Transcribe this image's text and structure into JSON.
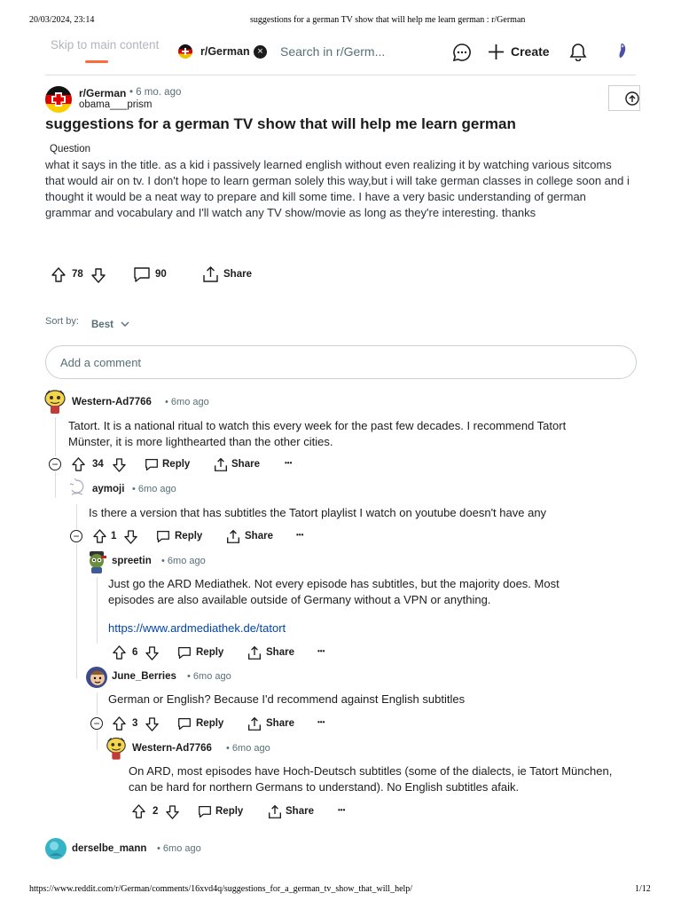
{
  "print_header": {
    "datetime": "20/03/2024, 23:14",
    "doc_title": "suggestions for a german TV show that will help me learn german : r/German"
  },
  "print_footer": {
    "url": "https://www.reddit.com/r/German/comments/16xvd4q/suggestions_for_a_german_tv_show_that_will_help/",
    "page": "1/12"
  },
  "topbar": {
    "skip_link": "Skip to main content",
    "subreddit_chip": "r/German",
    "chip_close": "×",
    "search_placeholder": "Search in r/Germ...",
    "create_label": "Create"
  },
  "post": {
    "subreddit": "r/German",
    "time": "• 6 mo. ago",
    "author": "obama___prism",
    "title": "suggestions for a german TV show that will help me learn german",
    "flair": "Question",
    "body": "what it says in the title. as a kid i passively learned english without even realizing it by watching various sitcoms that would air on tv. I don't hope to learn german solely this way,but i will take german classes in college soon and i thought it would be a neat way to prepare and kill some time. I have a very basic understanding of german grammar and vocabulary and I'll watch any TV show/movie as long as they're interesting. thanks",
    "votes": "78",
    "comments": "90",
    "share": "Share"
  },
  "sort": {
    "label": "Sort by:",
    "value": "Best"
  },
  "add_comment": "Add a comment",
  "comments": [
    {
      "user": "Western-Ad7766",
      "time": "• 6mo ago",
      "text": "Tatort. It is a national ritual to watch this every week for the past few decades. I recommend Tatort Münster, it is more lighthearted than the other cities.",
      "votes": "34",
      "reply": "Reply",
      "share": "Share",
      "more": "•••"
    },
    {
      "user": "aymoji",
      "time": "• 6mo ago",
      "text": "Is there a version that has subtitles the Tatort playlist I watch on youtube doesn't have any",
      "votes": "1",
      "reply": "Reply",
      "share": "Share",
      "more": "•••"
    },
    {
      "user": "spreetin",
      "time": "• 6mo ago",
      "text": "Just go the ARD Mediathek. Not every episode has subtitles, but the majority does. Most episodes are also available outside of Germany without a VPN or anything.",
      "link": "https://www.ardmediathek.de/tatort",
      "votes": "6",
      "reply": "Reply",
      "share": "Share",
      "more": "•••"
    },
    {
      "user": "June_Berries",
      "time": "• 6mo ago",
      "text": "German or English? Because I'd recommend against English subtitles",
      "votes": "3",
      "reply": "Reply",
      "share": "Share",
      "more": "•••"
    },
    {
      "user": "Western-Ad7766",
      "time": "• 6mo ago",
      "text": "On ARD, most episodes have Hoch-Deutsch subtitles (some of the dialects, ie Tatort München, can be hard for northern Germans to understand). No English subtitles afaik.",
      "votes": "2",
      "reply": "Reply",
      "share": "Share",
      "more": "•••"
    },
    {
      "user": "derselbe_mann",
      "time": "• 6mo ago"
    }
  ]
}
